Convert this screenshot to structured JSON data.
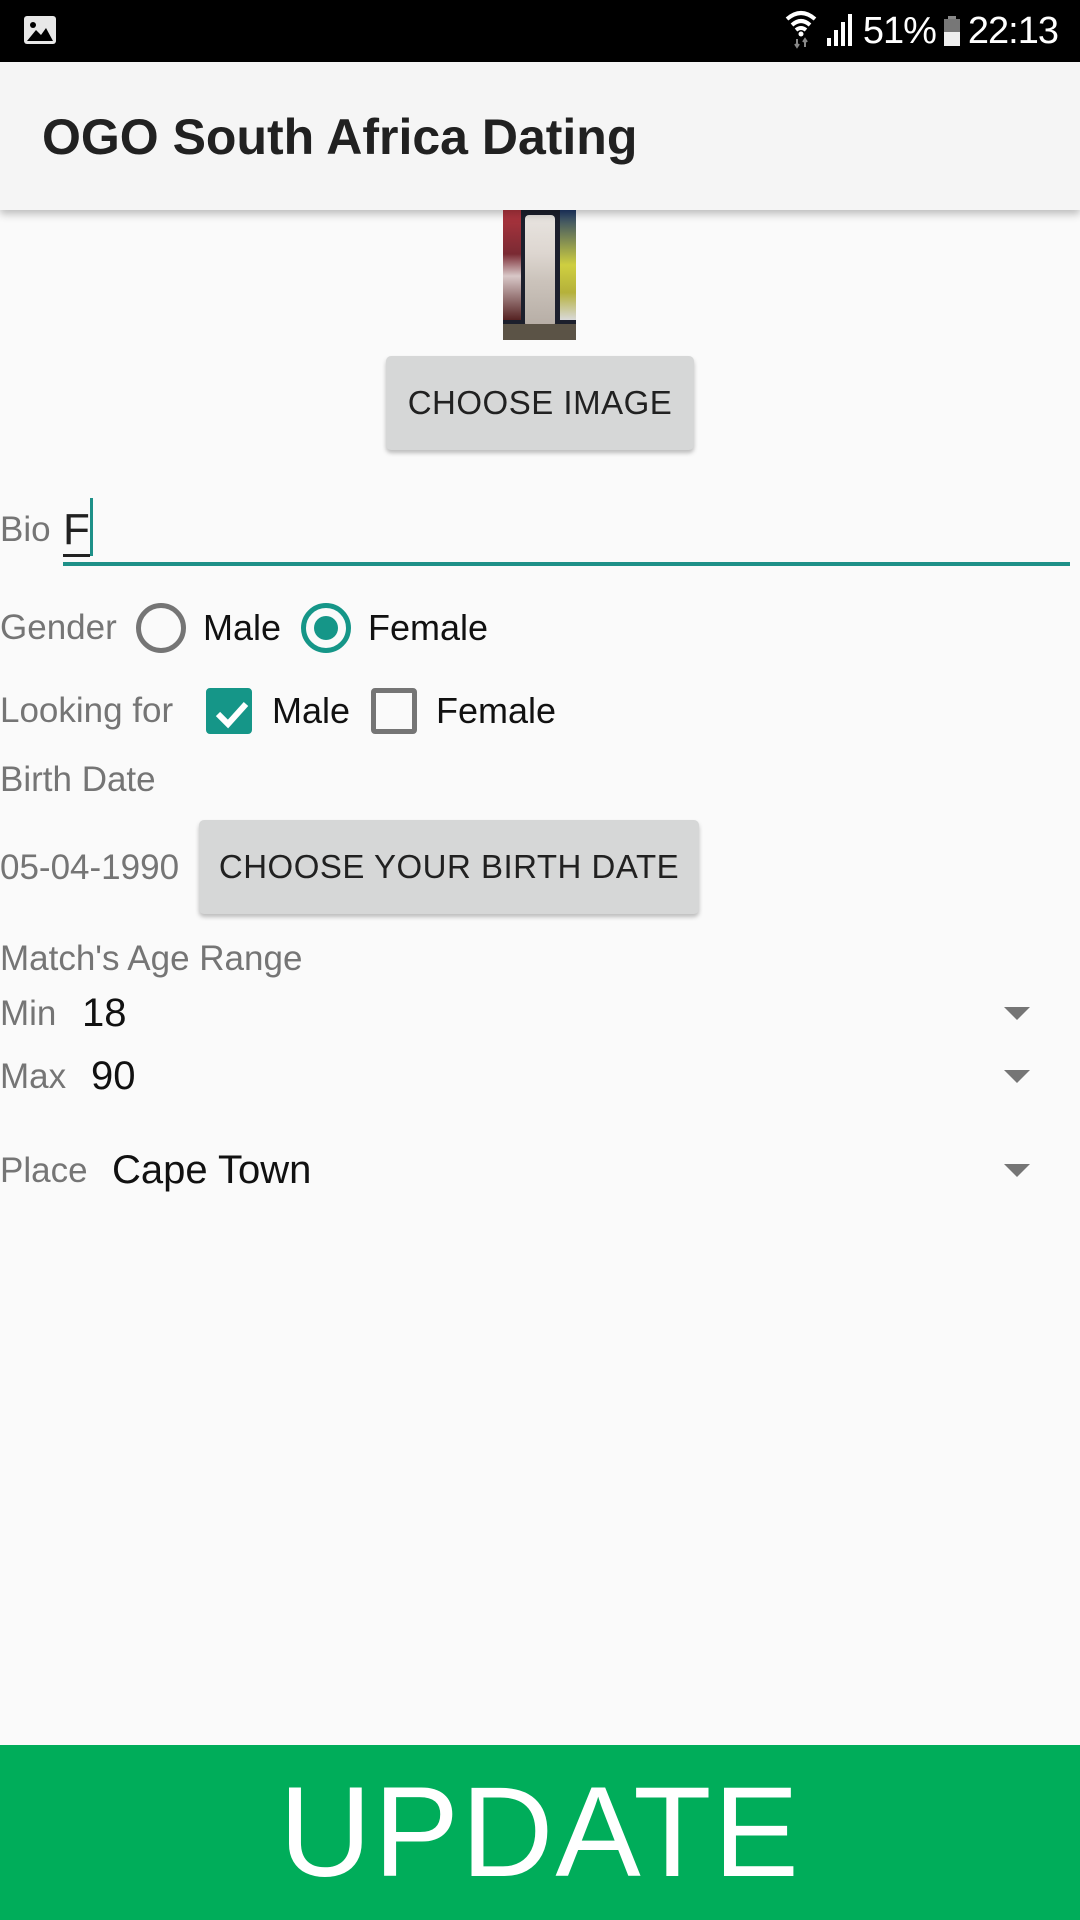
{
  "status_bar": {
    "notification_icon": "gallery-icon",
    "wifi_icon": "wifi-icon",
    "signal_icon": "signal-icon",
    "battery_percent": "51%",
    "battery_level": 0.51,
    "time": "22:13"
  },
  "app_bar": {
    "title": "OGO South Africa Dating"
  },
  "profile": {
    "image_alt": "profile-photo",
    "choose_image_label": "CHOOSE IMAGE"
  },
  "bio": {
    "label": "Bio",
    "value": "F"
  },
  "gender": {
    "label": "Gender",
    "options": [
      {
        "label": "Male",
        "checked": false
      },
      {
        "label": "Female",
        "checked": true
      }
    ]
  },
  "looking_for": {
    "label": "Looking for",
    "options": [
      {
        "label": "Male",
        "checked": true
      },
      {
        "label": "Female",
        "checked": false
      }
    ]
  },
  "birth_date": {
    "label": "Birth Date",
    "value": "05-04-1990",
    "button_label": "CHOOSE YOUR BIRTH DATE"
  },
  "age_range": {
    "label": "Match's Age Range",
    "min_label": "Min",
    "min_value": "18",
    "max_label": "Max",
    "max_value": "90"
  },
  "place": {
    "label": "Place",
    "value": "Cape Town"
  },
  "colors": {
    "accent": "#159688",
    "update_button": "#00ad5a"
  },
  "update_label": "UPDATE"
}
